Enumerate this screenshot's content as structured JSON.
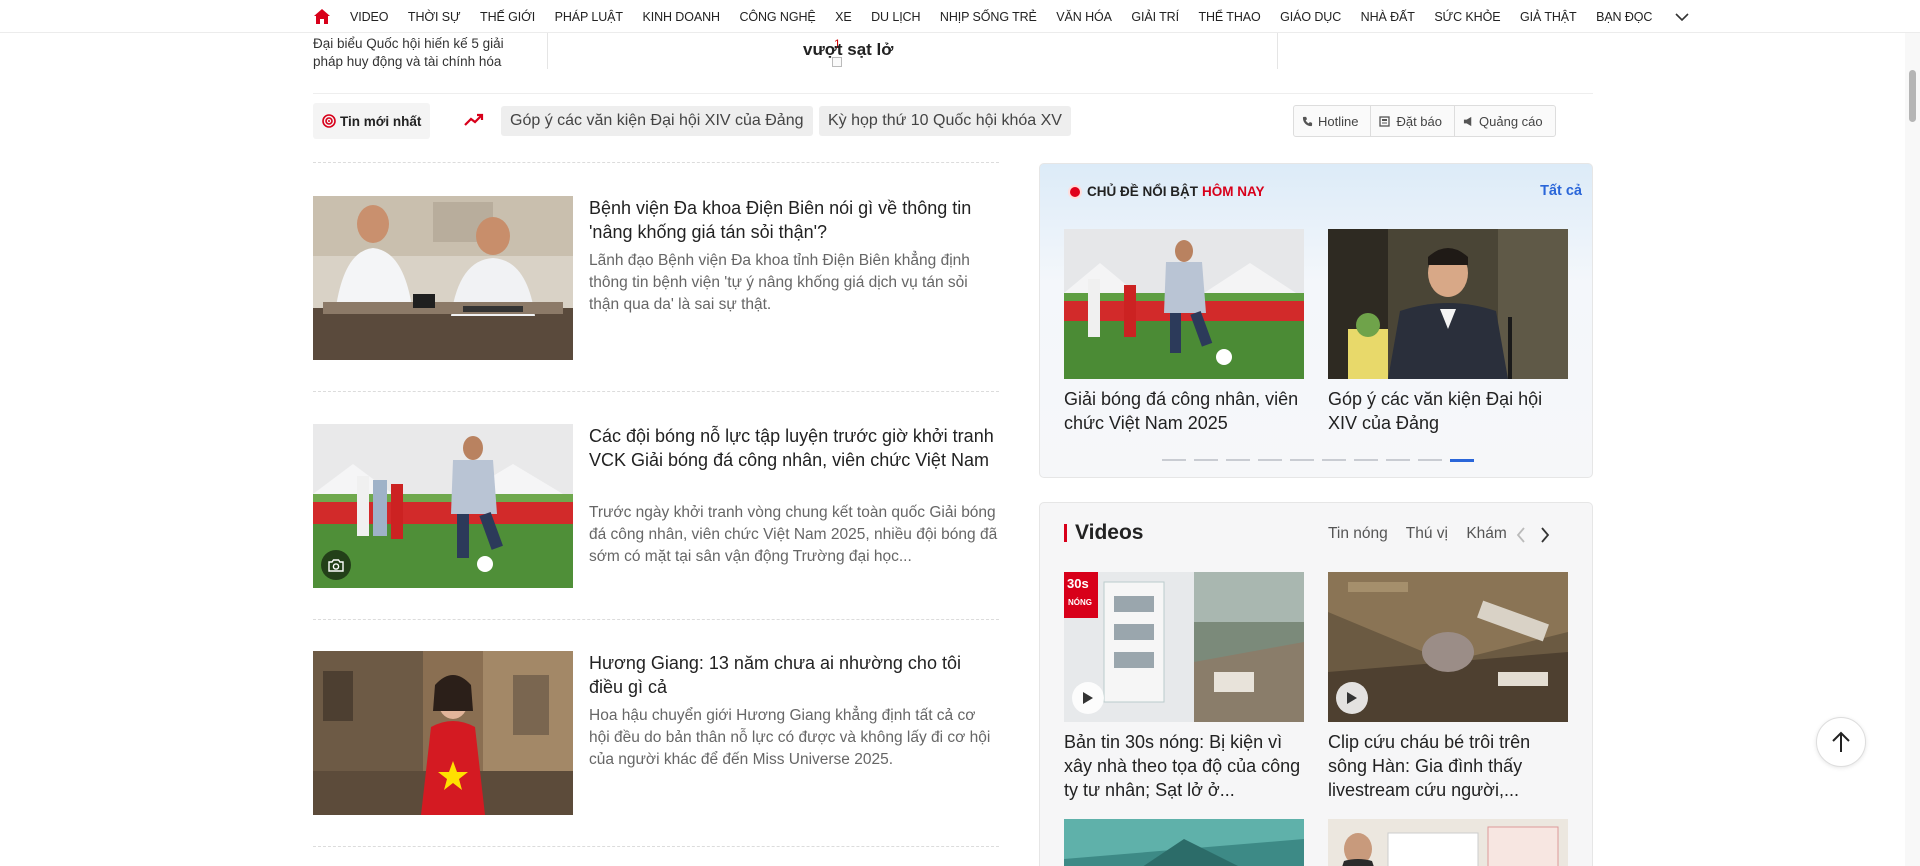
{
  "nav": {
    "items": [
      "VIDEO",
      "THỜI SỰ",
      "THẾ GIỚI",
      "PHÁP LUẬT",
      "KINH DOANH",
      "CÔNG NGHỆ",
      "XE",
      "DU LỊCH",
      "NHỊP SỐNG TRẺ",
      "VĂN HÓA",
      "GIẢI TRÍ",
      "THỂ THAO",
      "GIÁO DỤC",
      "NHÀ ĐẤT",
      "SỨC KHỎE",
      "GIẢ THẬT",
      "BẠN ĐỌC"
    ]
  },
  "previous": {
    "poll_text": "Đại biểu Quốc hội hiến kế 5 giải pháp huy động và tài chính hóa",
    "poll_count": "1",
    "title_tail": "vượt sạt lở"
  },
  "tagbar": {
    "latest": "Tin mới nhất",
    "tags": [
      "Góp ý các văn kiện Đại hội XIV của Đảng",
      "Kỳ họp thứ 10 Quốc hội khóa XV"
    ],
    "hotline": "Hotline",
    "subscribe": "Đặt báo",
    "ads": "Quảng cáo"
  },
  "articles": [
    {
      "title": "Bệnh viện Đa khoa Điện Biên nói gì về thông tin 'nâng khống giá tán sỏi thận'?",
      "sapo": "Lãnh đạo Bệnh viện Đa khoa tỉnh Điện Biên khẳng định thông tin bệnh viện 'tự ý nâng khống giá dịch vụ tán sỏi thận qua da' là sai sự thật."
    },
    {
      "title": "Các đội bóng nỗ lực tập luyện trước giờ khởi tranh VCK Giải bóng đá công nhân, viên chức Việt Nam",
      "sapo": "Trước ngày khởi tranh vòng chung kết toàn quốc Giải bóng đá công nhân, viên chức Việt Nam 2025, nhiều đội bóng đã sớm có mặt tại sân vận động Trường đại học..."
    },
    {
      "title": "Hương Giang: 13 năm chưa ai nhường cho tôi điều gì cả",
      "sapo": "Hoa hậu chuyển giới Hương Giang khẳng định tất cả cơ hội đều do bản thân nỗ lực có được và không lấy đi cơ hội của người khác để đến Miss Universe 2025."
    }
  ],
  "hot": {
    "heading": "CHỦ ĐỀ NỔI BẬT",
    "heading_accent": "HÔM NAY",
    "all": "Tất cả",
    "cards": [
      "Giải bóng đá công nhân, viên chức Việt Nam 2025",
      "Góp ý các văn kiện Đại hội XIV của Đảng"
    ],
    "slide_count": 10,
    "active_slide": 10
  },
  "videos": {
    "heading": "Videos",
    "tabs": [
      "Tin nóng",
      "Thú vị",
      "Khám phá"
    ],
    "cards": [
      "Bản tin 30s nóng: Bị kiện vì xây nhà theo tọa độ của công ty tư nhân; Sạt lở ở...",
      "Clip cứu cháu bé trôi trên sông Hàn: Gia đình thấy livestream cứu người,..."
    ],
    "badge_30s": "30s",
    "badge_nong": "NÓNG"
  },
  "colors": {
    "brand_red": "#d8001a",
    "link_blue": "#2a66d9"
  }
}
